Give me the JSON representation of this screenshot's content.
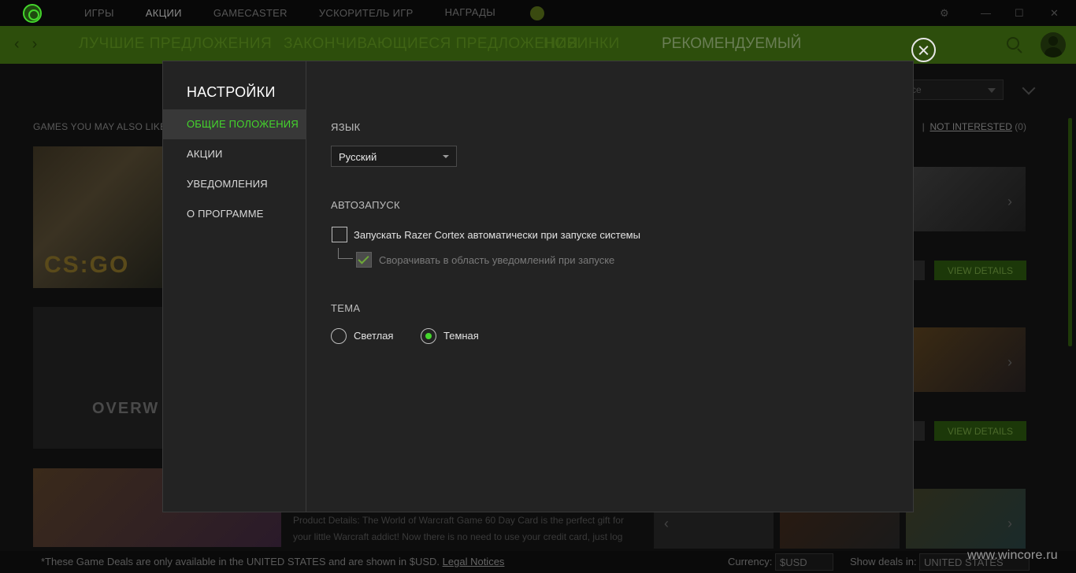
{
  "topnav": {
    "items": [
      "ИГРЫ",
      "АКЦИИ",
      "GAMECASTER",
      "УСКОРИТЕЛЬ ИГР",
      "НАГРАДЫ"
    ],
    "active_index": 1
  },
  "subnav": {
    "faded_tabs": [
      "ЛУЧШИЕ ПРЕДЛОЖЕНИЯ",
      "ЗАКОНЧИВАЮЩИЕСЯ ПРЕДЛОЖЕНИЯ",
      "НОВИНКИ"
    ],
    "current_tab": "РЕКОМЕНДУЕМЫЙ"
  },
  "background": {
    "heading": "GAMES YOU MAY ALSO LIKE",
    "not_interested_label": "NOT INTERESTED",
    "not_interested_count": "(0)",
    "other_count": "0)",
    "sort_value": "ce",
    "view_details": "VIEW DETAILS",
    "description": "Product Details: The World of Warcraft Game 60 Day Card is the perfect gift for your little Warcraft addict! Now there is no need to use your credit card, just log",
    "tile1_text": "CS:GO",
    "tile2_text": "OVERW"
  },
  "footer": {
    "note": "*These Game Deals are only available in the UNITED STATES and are shown in $USD.",
    "legal_link": "Legal Notices",
    "currency_label": "Currency:",
    "currency_value": "$USD",
    "show_deals_label": "Show deals in:",
    "show_deals_value": "UNITED STATES"
  },
  "watermark": "www.wincore.ru",
  "settings": {
    "title": "НАСТРОЙКИ",
    "sidebar": [
      {
        "label": "ОБЩИЕ ПОЛОЖЕНИЯ",
        "active": true
      },
      {
        "label": "АКЦИИ",
        "active": false
      },
      {
        "label": "УВЕДОМЛЕНИЯ",
        "active": false
      },
      {
        "label": "О ПРОГРАММЕ",
        "active": false
      }
    ],
    "language": {
      "label": "ЯЗЫК",
      "value": "Русский"
    },
    "autostart": {
      "label": "АВТОЗАПУСК",
      "launch_label": "Запускать Razer Cortex автоматически при запуске системы",
      "launch_checked": false,
      "minimize_label": "Сворачивать в область уведомлений при запуске",
      "minimize_checked": true,
      "minimize_disabled": true
    },
    "theme": {
      "label": "ТЕМА",
      "options": [
        "Светлая",
        "Темная"
      ],
      "selected_index": 1
    }
  },
  "colors": {
    "accent": "#44d62c",
    "modal_bg": "#232323",
    "subnav_bg": "#2d4e0c",
    "active_item_bg": "#383838"
  }
}
